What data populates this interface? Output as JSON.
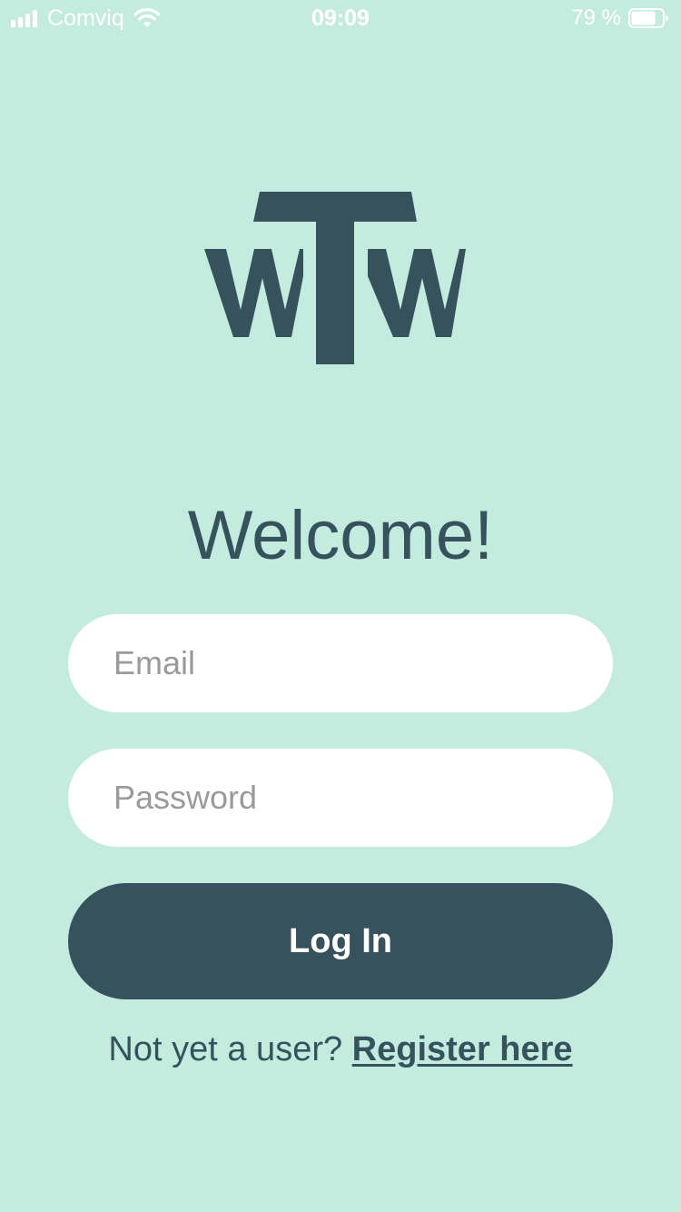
{
  "status_bar": {
    "carrier": "Comviq",
    "time": "09:09",
    "battery": "79 %",
    "battery_level": 0.79
  },
  "colors": {
    "background": "#c3ebde",
    "primary": "#36535d",
    "field_background": "#ffffff",
    "placeholder": "#9a9a9a"
  },
  "logo": {
    "text": "WTW"
  },
  "welcome": {
    "title": "Welcome!"
  },
  "form": {
    "email": {
      "value": "",
      "placeholder": "Email"
    },
    "password": {
      "value": "",
      "placeholder": "Password"
    },
    "login_label": "Log In"
  },
  "register": {
    "prompt": "Not yet a user?",
    "link_label": "Register here"
  }
}
